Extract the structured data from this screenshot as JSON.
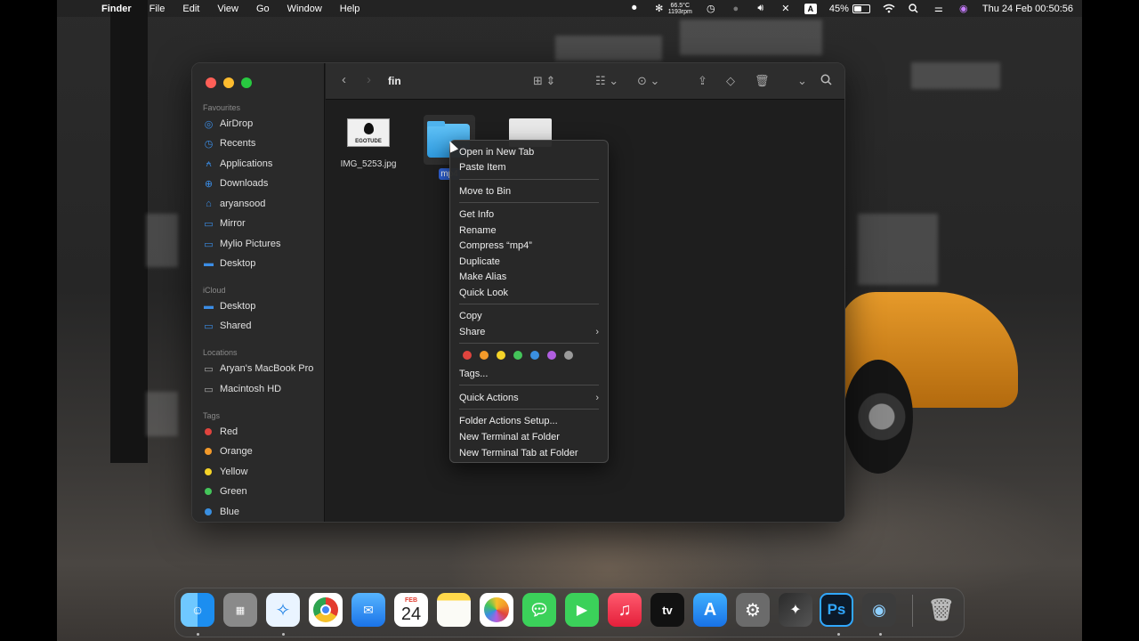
{
  "menubar": {
    "app": "Finder",
    "menus": [
      "File",
      "Edit",
      "View",
      "Go",
      "Window",
      "Help"
    ],
    "temp": "66.5°C",
    "rpm": "1193rpm",
    "input_source": "A",
    "battery": "45%",
    "clock": "Thu 24 Feb  00:50:56"
  },
  "finder": {
    "title": "fin",
    "sidebar": {
      "favourites_header": "Favourites",
      "favourites": [
        "AirDrop",
        "Recents",
        "Applications",
        "Downloads",
        "aryansood",
        "Mirror",
        "Mylio Pictures",
        "Desktop"
      ],
      "icloud_header": "iCloud",
      "icloud": [
        "Desktop",
        "Shared"
      ],
      "locations_header": "Locations",
      "locations": [
        "Aryan's MacBook Pro",
        "Macintosh HD"
      ],
      "tags_header": "Tags",
      "tags": [
        {
          "name": "Red",
          "color": "#e0443e"
        },
        {
          "name": "Orange",
          "color": "#f39a2a"
        },
        {
          "name": "Yellow",
          "color": "#f5d328"
        },
        {
          "name": "Green",
          "color": "#44c55a"
        },
        {
          "name": "Blue",
          "color": "#3a8fe0"
        }
      ]
    },
    "files": [
      {
        "name": "IMG_5253.jpg",
        "thumb_text": "EGOTUDE"
      },
      {
        "name": "mp4"
      },
      {
        "name": ""
      }
    ]
  },
  "context_menu": {
    "items_a": [
      "Open in New Tab",
      "Paste Item"
    ],
    "items_b": [
      "Move to Bin"
    ],
    "items_c": [
      "Get Info",
      "Rename",
      "Compress “mp4”",
      "Duplicate",
      "Make Alias",
      "Quick Look"
    ],
    "items_d": [
      "Copy",
      "Share"
    ],
    "tag_colors": [
      "#e0443e",
      "#f39a2a",
      "#f5d328",
      "#44c55a",
      "#3a8fe0",
      "#b05ee0",
      "#9a9a9a"
    ],
    "tags_item": "Tags...",
    "quick_actions": "Quick Actions",
    "items_e": [
      "Folder Actions Setup...",
      "New Terminal at Folder",
      "New Terminal Tab at Folder"
    ]
  },
  "dock": {
    "calendar_month": "FEB",
    "calendar_day": "24",
    "tv_label": "tv",
    "ps_label": "Ps"
  }
}
